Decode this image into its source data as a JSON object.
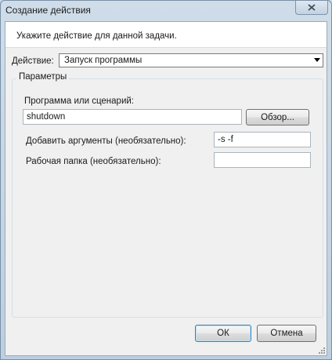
{
  "window": {
    "title": "Создание действия"
  },
  "header": {
    "instruction": "Укажите действие для данной задачи."
  },
  "action": {
    "label": "Действие:",
    "selected": "Запуск программы"
  },
  "params": {
    "group_label": "Параметры",
    "program_label": "Программа или сценарий:",
    "program_value": "shutdown",
    "browse_label": "Обзор...",
    "args_label": "Добавить аргументы (необязательно):",
    "args_value": "-s -f",
    "workdir_label": "Рабочая папка (необязательно):",
    "workdir_value": ""
  },
  "footer": {
    "ok_label": "ОК",
    "cancel_label": "Отмена"
  }
}
